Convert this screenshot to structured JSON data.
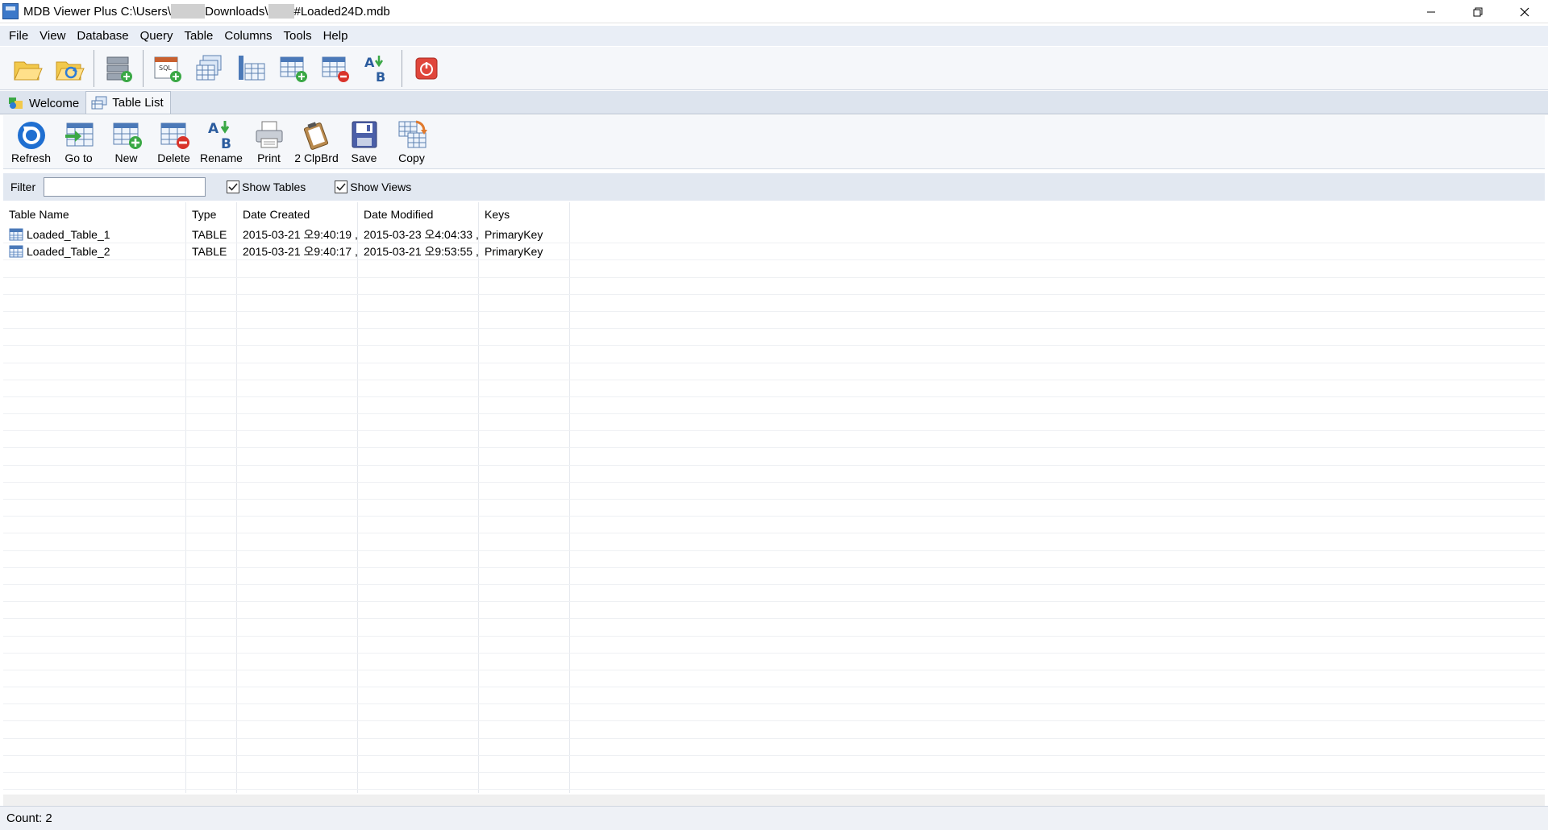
{
  "window": {
    "title_prefix": "MDB Viewer Plus C:\\Users\\",
    "title_mid": "Downloads\\",
    "title_suffix": "#Loaded24D.mdb"
  },
  "menu": [
    "File",
    "View",
    "Database",
    "Query",
    "Table",
    "Columns",
    "Tools",
    "Help"
  ],
  "tabs": [
    {
      "label": "Welcome",
      "active": false
    },
    {
      "label": "Table List",
      "active": true
    }
  ],
  "subtoolbar": {
    "refresh": "Refresh",
    "goto": "Go to",
    "new": "New",
    "delete": "Delete",
    "rename": "Rename",
    "print": "Print",
    "clipboard": "2 ClpBrd",
    "save": "Save",
    "copy": "Copy"
  },
  "filter": {
    "label": "Filter",
    "value": "",
    "show_tables": "Show Tables",
    "show_tables_checked": true,
    "show_views": "Show Views",
    "show_views_checked": true
  },
  "grid": {
    "columns": [
      "Table Name",
      "Type",
      "Date Created",
      "Date Modified",
      "Keys"
    ],
    "rows": [
      [
        "Loaded_Table_1",
        "TABLE",
        "2015-03-21 오9:40:19 ,",
        "2015-03-23 오4:04:33 ,",
        "PrimaryKey"
      ],
      [
        "Loaded_Table_2",
        "TABLE",
        "2015-03-21 오9:40:17 ,",
        "2015-03-21 오9:53:55 ,",
        "PrimaryKey"
      ]
    ]
  },
  "status": {
    "count": "Count: 2"
  },
  "colors": {
    "accent": "#3b78c9",
    "menubar_bg": "#e9eef6",
    "filter_bg": "#e2e8f1"
  }
}
